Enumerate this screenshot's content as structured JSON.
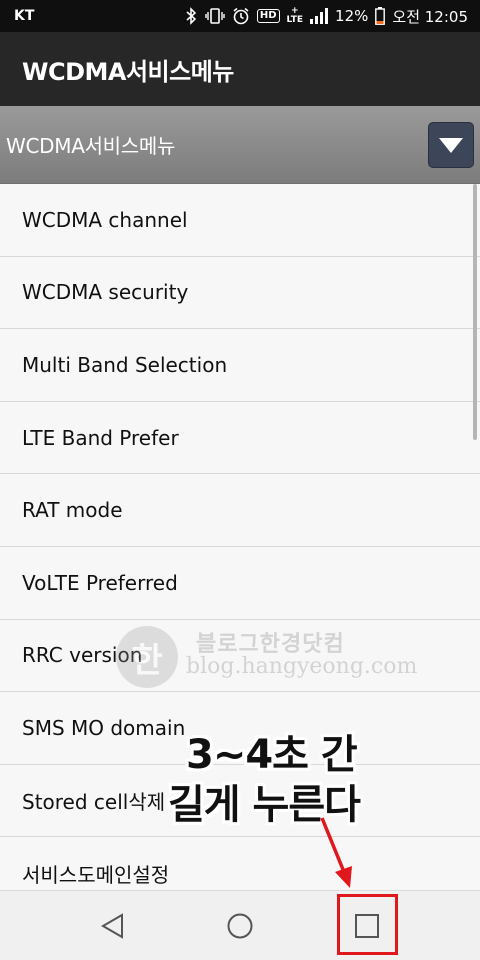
{
  "status_bar": {
    "carrier": "KT",
    "icons": [
      "bluetooth-icon",
      "vibrate-icon",
      "alarm-icon",
      "hd-voice-icon",
      "lte-icon",
      "signal-icon",
      "battery-icon"
    ],
    "hd_label": "HD",
    "lte_label": "LTE",
    "lte_plus": "+",
    "battery_percent": "12%",
    "time": "오전 12:05"
  },
  "app_bar": {
    "title": "WCDMA서비스메뉴"
  },
  "spinner": {
    "selected": "WCDMA서비스메뉴"
  },
  "menu": {
    "items": [
      "WCDMA channel",
      "WCDMA security",
      "Multi Band Selection",
      "LTE Band Prefer",
      "RAT mode",
      "VoLTE Preferred",
      "RRC version",
      "SMS MO domain",
      "Stored cell삭제",
      "서비스도메인설정"
    ]
  },
  "watermark": {
    "logo_char": "한",
    "line1": "블로그한경닷컴",
    "line2": "blog.hangyeong.com"
  },
  "overlay": {
    "line1": "3~4초 간",
    "line2": "길게 누른다"
  },
  "colors": {
    "accent": "#e0181d",
    "app_bar": "#272727",
    "spinner_button": "#3c4658"
  },
  "nav_bar": {
    "icons": [
      "back-icon",
      "home-icon",
      "recent-apps-icon"
    ]
  }
}
